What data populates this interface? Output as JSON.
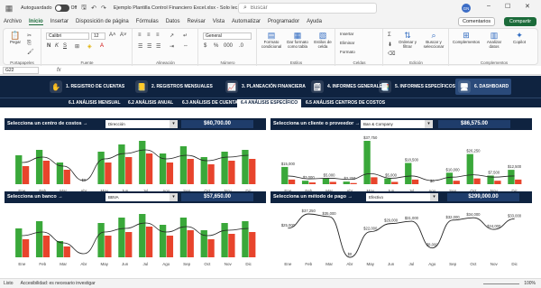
{
  "titlebar": {
    "autosave_label": "Autoguardado",
    "toggle_state": "Off",
    "doc_title": "Ejemplo Plantilla Control Financiero Excel.xlsx  -  Solo lec... ⌄",
    "search_placeholder": "Buscar",
    "avatar": "GN"
  },
  "menu": {
    "items": [
      "Archivo",
      "Inicio",
      "Insertar",
      "Disposición de página",
      "Fórmulas",
      "Datos",
      "Revisar",
      "Vista",
      "Automatizar",
      "Programador",
      "Ayuda"
    ],
    "active": "Inicio",
    "comments_label": "Comentarios",
    "share_label": "Compartir"
  },
  "ribbon": {
    "paste_label": "Pegar",
    "font_name": "Calibri",
    "font_size": "12",
    "number_format": "General",
    "conditional_label": "Formato condicional",
    "table_label": "Dar formato como tabla",
    "styles_label": "Estilos de celda",
    "insert_label": "Insertar",
    "delete_label": "Eliminar",
    "format_label": "Formato",
    "sort_label": "Ordenar y filtrar",
    "find_label": "Buscar y seleccionar",
    "addins_label": "Complementos",
    "analyze_label": "Analizar datos",
    "copilot_label": "Copilot",
    "group_clipboard": "Portapapeles",
    "group_font": "Fuente",
    "group_alignment": "Alineación",
    "group_number": "Número",
    "group_styles": "Estilos",
    "group_cells": "Celdas",
    "group_editing": "Edición",
    "group_addins": "Complementos"
  },
  "formula_bar": {
    "cell_ref": "G22",
    "fx": "fx"
  },
  "nav_tabs": [
    {
      "label": "1. REGISTRO DE CUENTAS",
      "icon": "hand-money-icon"
    },
    {
      "label": "2. REGISTROS MENSUALES",
      "icon": "ledger-icon"
    },
    {
      "label": "3. PLANEACIÓN FINANCIERA",
      "icon": "chart-icon"
    },
    {
      "label": "4. INFORMES GENERALES",
      "icon": "report-icon"
    },
    {
      "label": "5. INFORMES ESPECÍFICOS",
      "icon": "report-specific-icon"
    },
    {
      "label": "6. DASHBOARD",
      "icon": "dashboard-icon"
    }
  ],
  "sub_tabs": [
    "6.1 ANÁLISIS MENSUAL",
    "6.2 ANÁLISIS ANUAL",
    "6.3 ANÁLISIS DE CUENTAS",
    "6.4 ANÁLISIS ESPECÍFICO",
    "6.5 ANÁLISIS CENTROS DE COSTOS"
  ],
  "sub_tab_active": "6.4 ANÁLISIS ESPECÍFICO",
  "panels": {
    "costos": {
      "label": "Selecciona un centro de costos →",
      "selected": "Dirección",
      "value": "$60,700.00"
    },
    "cliente": {
      "label": "Selecciona un cliente o proveedor →",
      "selected": "Ban & Company",
      "value": "$86,575.00"
    },
    "banco": {
      "label": "Selecciona un banco →",
      "selected": "BBVA",
      "value": "$57,650.00"
    },
    "pago": {
      "label": "Selecciona un método de pago →",
      "selected": "Efectivo",
      "value": "$299,000.00"
    }
  },
  "colors": {
    "navy": "#0f2340",
    "green": "#3aa83a",
    "red": "#e8442c",
    "line": "#222222"
  },
  "chart_data": [
    {
      "type": "bar",
      "title": "Selecciona un centro de costos",
      "categories": [
        "Ene",
        "Feb",
        "Mar",
        "Abr",
        "May",
        "Jun",
        "Jul",
        "Ago",
        "Sep",
        "Oct",
        "Nov",
        "Dic"
      ],
      "series": [
        {
          "values": [
            8000,
            9500,
            6000,
            0,
            9000,
            11000,
            12000,
            8500,
            10500,
            7500,
            9000,
            9500
          ]
        },
        {
          "values": [
            5000,
            6500,
            4000,
            0,
            6000,
            7500,
            8500,
            6000,
            7000,
            5500,
            6500,
            7000
          ]
        }
      ],
      "data_labels": [
        "$0"
      ]
    },
    {
      "type": "bar",
      "title": "Selecciona un cliente o proveedor",
      "categories": [
        "Ene",
        "Feb",
        "Mar",
        "Abr",
        "May",
        "Jun",
        "Jul",
        "Ago",
        "Sep",
        "Oct",
        "Nov",
        "Dic"
      ],
      "series": [
        {
          "values": [
            15000,
            3000,
            5000,
            2250,
            37750,
            5000,
            18500,
            0,
            10000,
            26250,
            7500,
            12500
          ]
        },
        {
          "values": [
            4000,
            1500,
            2000,
            1000,
            6000,
            2000,
            4000,
            0,
            3000,
            5000,
            3000,
            4000
          ]
        }
      ],
      "data_labels": [
        "$15,000",
        "$3,000",
        "$5,000",
        "$2,250",
        "$37,750",
        "$5,000",
        "$18,500",
        "$0",
        "$10,000",
        "$26,250",
        "$7,500",
        "$12,500"
      ]
    },
    {
      "type": "bar",
      "title": "Selecciona un banco",
      "categories": [
        "Ene",
        "Feb",
        "Mar",
        "Abr",
        "May",
        "Jun",
        "Jul",
        "Ago",
        "Sep",
        "Oct",
        "Nov",
        "Dic"
      ],
      "series": [
        {
          "values": [
            8000,
            10000,
            4500,
            0,
            9500,
            11000,
            12000,
            9000,
            11000,
            7500,
            9500,
            10000
          ]
        },
        {
          "values": [
            5000,
            6000,
            3000,
            0,
            6000,
            7000,
            8500,
            6000,
            7500,
            5000,
            6500,
            7000
          ]
        }
      ],
      "data_labels": []
    },
    {
      "type": "line",
      "title": "Selecciona un método de pago",
      "categories": [
        "Ene",
        "Feb",
        "Mar",
        "Abr",
        "May",
        "Jun",
        "Jul",
        "Ago",
        "Sep",
        "Oct",
        "Nov",
        "Dic"
      ],
      "series": [
        {
          "values": [
            25000,
            37250,
            35000,
            0,
            22000,
            29000,
            31000,
            8000,
            32000,
            34000,
            24000,
            33000
          ]
        }
      ],
      "data_labels": [
        "$25,000",
        "$37,250",
        "$35,000",
        "$0",
        "$22,000",
        "$29,000",
        "$31,000",
        "$8,000",
        "$32,000",
        "$34,000",
        "$24,000",
        "$33,000"
      ]
    }
  ],
  "status": {
    "ready": "Listo",
    "accessibility": "Accesibilidad: es necesario investigar",
    "zoom": "100%"
  }
}
